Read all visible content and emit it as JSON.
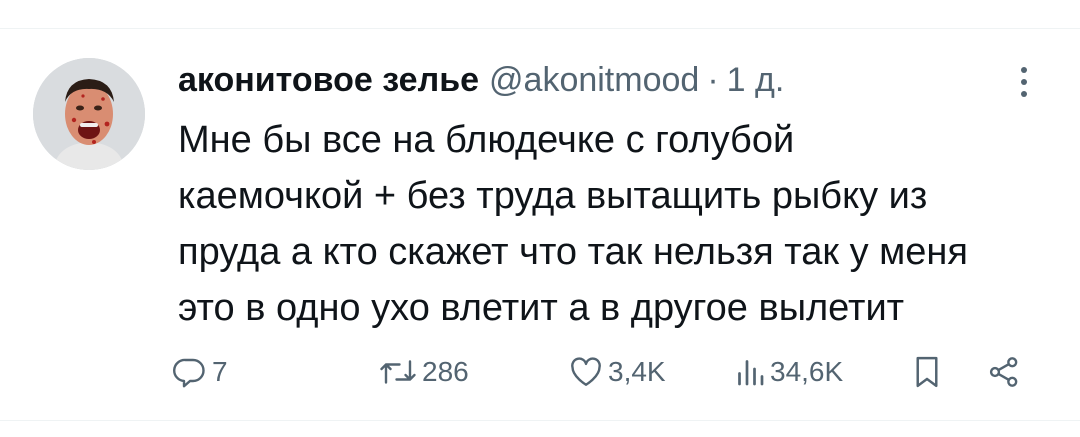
{
  "header": {
    "display_name": "аконитовое зелье",
    "handle": "@akonitmood",
    "separator": "·",
    "time": "1 д."
  },
  "tweet": {
    "lines": [
      "Мне бы все на блюдечке с голубой",
      "каемочкой + без труда вытащить рыбку из",
      "пруда а кто скажет что так нельзя так у меня",
      "это в одно ухо влетит а в другое вылетит"
    ]
  },
  "actions": {
    "replies": "7",
    "retweets": "286",
    "likes": "3,4K",
    "views": "34,6K"
  },
  "icons": {
    "reply": "reply-icon",
    "retweet": "retweet-icon",
    "like": "heart-icon",
    "views": "views-icon",
    "bookmark": "bookmark-icon",
    "share": "share-icon",
    "more": "more-options-icon"
  },
  "colors": {
    "text": "#0f1419",
    "muted": "#536471",
    "divider": "#eff3f4"
  }
}
